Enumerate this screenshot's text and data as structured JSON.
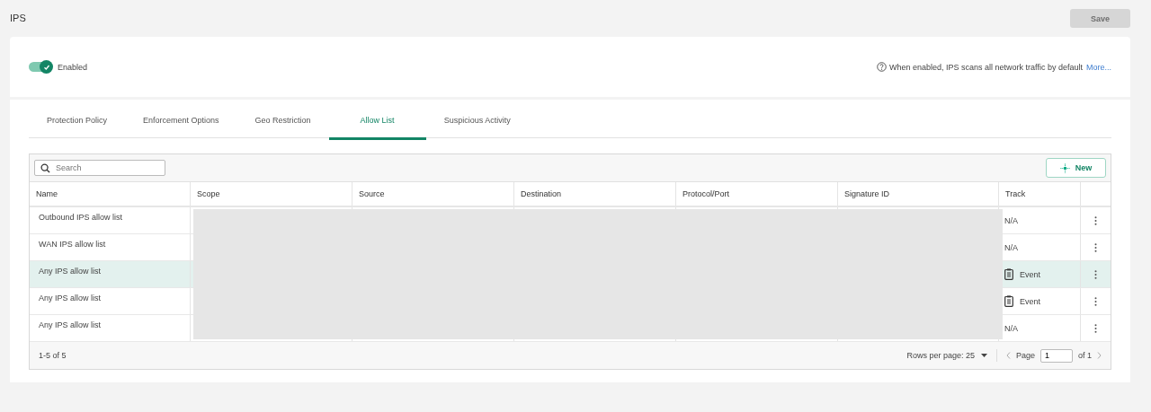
{
  "page": {
    "title": "IPS",
    "save_button": {
      "label": "Save",
      "disabled": true
    }
  },
  "status": {
    "toggle": {
      "label": "Enabled",
      "on": true
    },
    "info": "When enabled, IPS scans all network traffic by default",
    "more_link": "More..."
  },
  "tabs": [
    {
      "label": "Protection Policy",
      "selected": false
    },
    {
      "label": "Enforcement Options",
      "selected": false
    },
    {
      "label": "Geo Restriction",
      "selected": false
    },
    {
      "label": "Allow List",
      "selected": true
    },
    {
      "label": "Suspicious Activity",
      "selected": false
    }
  ],
  "search": {
    "placeholder": "Search"
  },
  "new_button": "New",
  "table": {
    "columns": [
      "Name",
      "Scope",
      "Source",
      "Destination",
      "Protocol/Port",
      "Signature ID",
      "Track"
    ],
    "rows": [
      {
        "name": "Outbound IPS allow list",
        "track": "N/A",
        "track_icon": false,
        "selected": false
      },
      {
        "name": "WAN IPS allow list",
        "track": "N/A",
        "track_icon": false,
        "selected": false
      },
      {
        "name": "Any IPS allow list",
        "track": "Event",
        "track_icon": true,
        "selected": true
      },
      {
        "name": "Any IPS allow list",
        "track": "Event",
        "track_icon": true,
        "selected": false
      },
      {
        "name": "Any IPS allow list",
        "track": "N/A",
        "track_icon": false,
        "selected": false
      }
    ]
  },
  "footer": {
    "count": "1-5 of 5",
    "rows_per_page": "Rows per page: 25",
    "page_label": "Page",
    "page_value": "1",
    "of_pages": "of 1"
  }
}
